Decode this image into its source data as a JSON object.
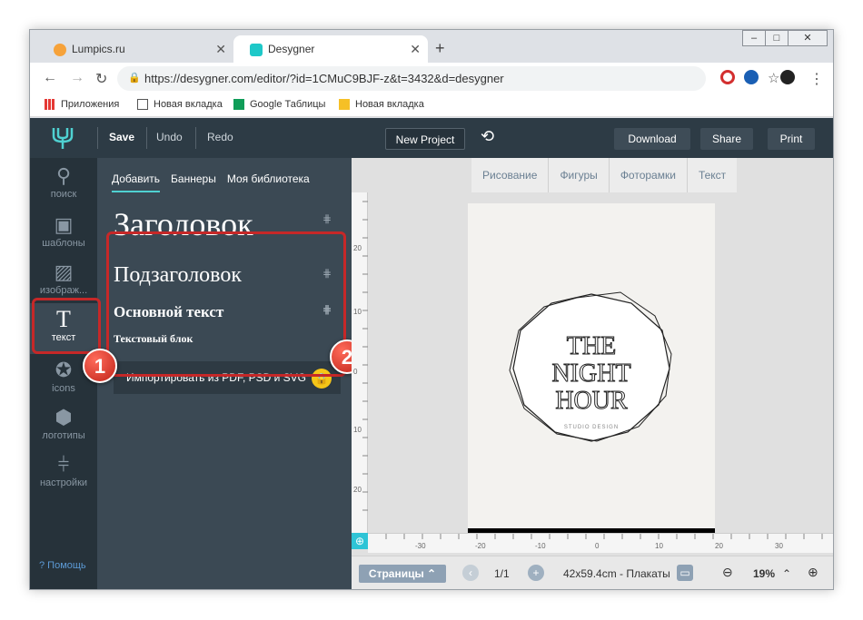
{
  "browser": {
    "tabs": [
      {
        "title": "Lumpics.ru",
        "active": false
      },
      {
        "title": "Desygner",
        "active": true
      }
    ],
    "new_tab": "+",
    "url": "https://desygner.com/editor/?id=1CMuC9BJF-z&t=3432&d=desygner",
    "bookmarks": [
      "Приложения",
      "Новая вкладка",
      "Google Таблицы",
      "Новая вкладка"
    ]
  },
  "toolbar": {
    "save": "Save",
    "undo": "Undo",
    "redo": "Redo",
    "new_project": "New Project",
    "download": "Download",
    "share": "Share",
    "print": "Print"
  },
  "sidebar": {
    "items": [
      {
        "label": "поиск",
        "icon": "search-icon"
      },
      {
        "label": "шаблоны",
        "icon": "template-icon"
      },
      {
        "label": "изображ...",
        "icon": "image-icon"
      },
      {
        "label": "текст",
        "icon": "text-icon"
      },
      {
        "label": "icons",
        "icon": "star-icon"
      },
      {
        "label": "логотипы",
        "icon": "logo-icon"
      },
      {
        "label": "настройки",
        "icon": "sliders-icon"
      }
    ],
    "help": "? Помощь"
  },
  "panel": {
    "tabs": [
      "Добавить",
      "Баннеры",
      "Моя библиотека"
    ],
    "heading": "Заголовок",
    "subheading": "Подзаголовок",
    "body": "Основной текст",
    "text_block": "Текстовый блок",
    "import": "Импортировать из PDF, PSD и SVG"
  },
  "canvas": {
    "tools": [
      "Рисование",
      "Фигуры",
      "Фоторамки",
      "Текст"
    ],
    "poster_title": [
      "THE",
      "NIGHT",
      "HOUR"
    ],
    "poster_sub": "STUDIO DESIGN",
    "ruler_labels_v": [
      "20",
      "10",
      "0",
      "10",
      "20"
    ],
    "ruler_labels_h": [
      "-30",
      "-20",
      "-10",
      "0",
      "10",
      "20",
      "30"
    ]
  },
  "bottom": {
    "pages": "Страницы",
    "page_count": "1/1",
    "size": "42x59.4cm - Плакаты",
    "zoom": "19%"
  },
  "annotations": {
    "badge1": "1",
    "badge2": "2"
  }
}
